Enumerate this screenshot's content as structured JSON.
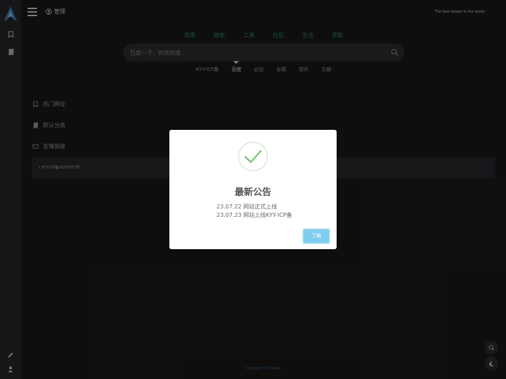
{
  "topbar": {
    "admin_label": "管理",
    "motto": "The best dream in the world."
  },
  "main_tabs": [
    "常用",
    "搜索",
    "工具",
    "社区",
    "生活",
    "求职"
  ],
  "search": {
    "placeholder": "百度一下，你就知道"
  },
  "engines": [
    "KYY-ICP备",
    "百度",
    "必应",
    "谷歌",
    "软件",
    "文献"
  ],
  "active_engine": "百度",
  "sections": {
    "hot": "热门网址",
    "default": "默认分类",
    "friends": "友情链接"
  },
  "friend_link": "KYY-ICP备20231072号",
  "copyright": "Copyright © TeaNav",
  "modal": {
    "title": "最新公告",
    "lines": [
      "23.07.22 网站正式上线",
      "23.07.23 网站上线KYY-ICP备"
    ],
    "button": "了解"
  },
  "colors": {
    "background": "#19191a",
    "sidebar": "#26272a",
    "tab_green": "#2b8e5d",
    "check_green": "#7cc576",
    "button_blue": "#7fcdf0"
  }
}
